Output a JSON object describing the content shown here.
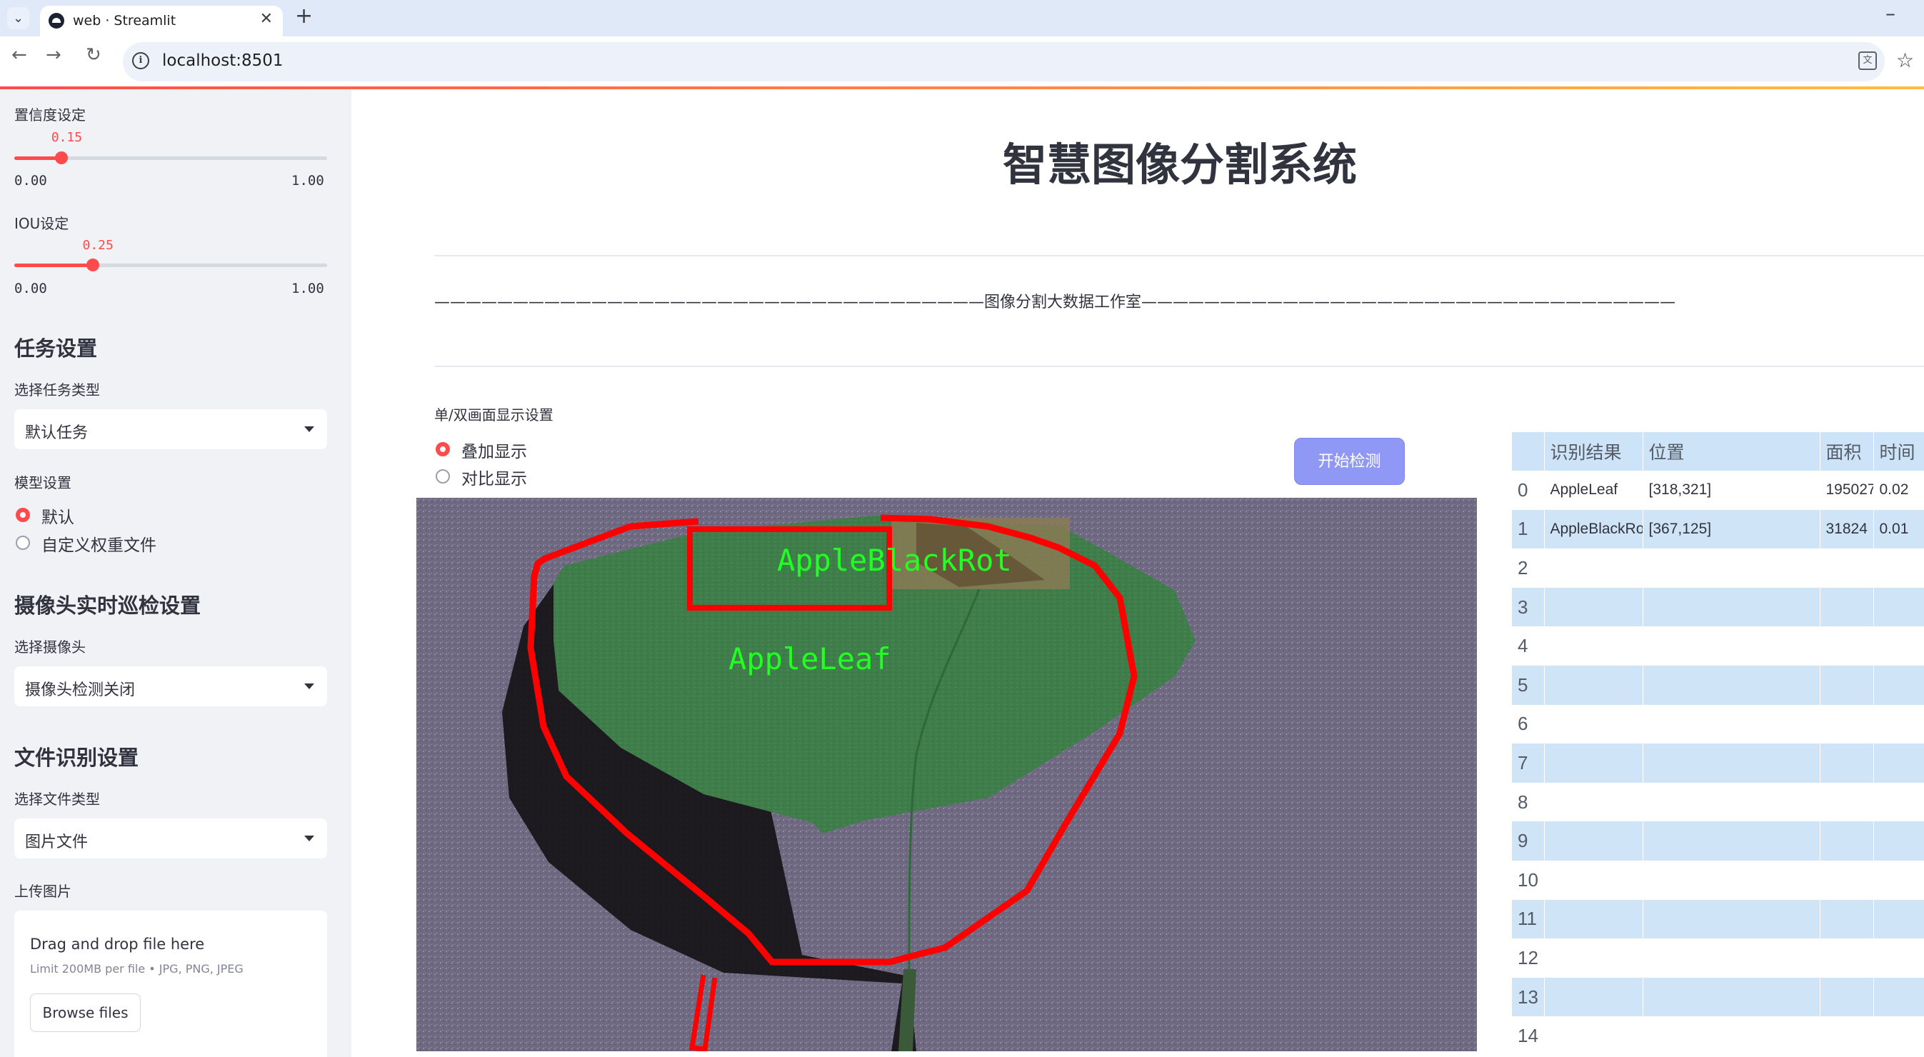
{
  "browser": {
    "tab_title": "web · Streamlit",
    "url": "localhost:8501"
  },
  "sidebar": {
    "confidence": {
      "label": "置信度设定",
      "value": "0.15",
      "value_num": 0.15,
      "min": "0.00",
      "max": "1.00"
    },
    "iou": {
      "label": "IOU设定",
      "value": "0.25",
      "value_num": 0.25,
      "min": "0.00",
      "max": "1.00"
    },
    "task_heading": "任务设置",
    "task_type_label": "选择任务类型",
    "task_type_value": "默认任务",
    "model_label": "模型设置",
    "model_options": [
      "默认",
      "自定义权重文件"
    ],
    "model_selected": "默认",
    "camera_heading": "摄像头实时巡检设置",
    "camera_label": "选择摄像头",
    "camera_value": "摄像头检测关闭",
    "file_heading": "文件识别设置",
    "file_type_label": "选择文件类型",
    "file_type_value": "图片文件",
    "upload_label": "上传图片",
    "upload_title": "Drag and drop file here",
    "upload_limit": "Limit 200MB per file • JPG, PNG, JPEG",
    "browse_label": "Browse files"
  },
  "main": {
    "title": "智慧图像分割系统",
    "studio_line": "———————————————————————————————————图像分割大数据工作室——————————————————————————————————",
    "display_mode_label": "单/双画面显示设置",
    "display_options": [
      "叠加显示",
      "对比显示"
    ],
    "display_selected": "叠加显示",
    "start_button": "开始检测",
    "detections": [
      {
        "label": "AppleBlackRot"
      },
      {
        "label": "AppleLeaf"
      }
    ]
  },
  "table": {
    "columns": [
      "",
      "识别结果",
      "位置",
      "面积",
      "时间"
    ],
    "rows": [
      [
        "0",
        "AppleLeaf",
        "[318,321]",
        "195027",
        "0.02"
      ],
      [
        "1",
        "AppleBlackRot",
        "[367,125]",
        "31824",
        "0.01"
      ],
      [
        "2",
        "",
        "",
        "",
        ""
      ],
      [
        "3",
        "",
        "",
        "",
        ""
      ],
      [
        "4",
        "",
        "",
        "",
        ""
      ],
      [
        "5",
        "",
        "",
        "",
        ""
      ],
      [
        "6",
        "",
        "",
        "",
        ""
      ],
      [
        "7",
        "",
        "",
        "",
        ""
      ],
      [
        "8",
        "",
        "",
        "",
        ""
      ],
      [
        "9",
        "",
        "",
        "",
        ""
      ],
      [
        "10",
        "",
        "",
        "",
        ""
      ],
      [
        "11",
        "",
        "",
        "",
        ""
      ],
      [
        "12",
        "",
        "",
        "",
        ""
      ],
      [
        "13",
        "",
        "",
        "",
        ""
      ],
      [
        "14",
        "",
        "",
        "",
        ""
      ]
    ]
  },
  "colors": {
    "accent": "#ff4b4b",
    "button": "#8f98f5",
    "table_header": "#cce3f8",
    "detection_box": "#ff0000",
    "detection_label": "#22ff22"
  }
}
